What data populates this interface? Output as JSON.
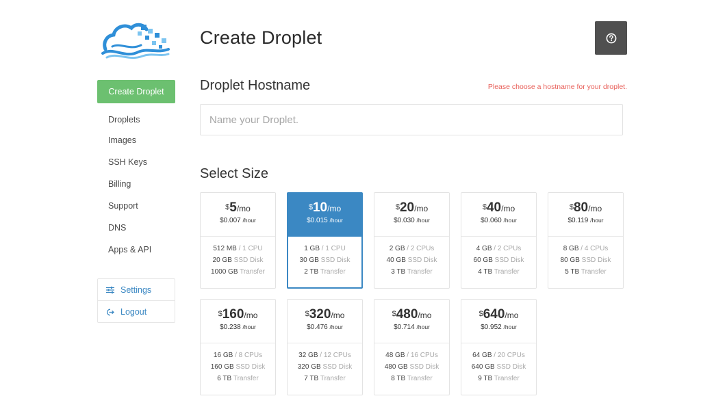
{
  "app": {
    "logo_icon": "cloud-logo-icon",
    "accent": "#3b88c3",
    "green": "#6cc070",
    "error_color": "#e8605a"
  },
  "sidebar": {
    "create_label": "Create Droplet",
    "items": [
      {
        "label": "Droplets"
      },
      {
        "label": "Images"
      },
      {
        "label": "SSH Keys"
      },
      {
        "label": "Billing"
      },
      {
        "label": "Support"
      },
      {
        "label": "DNS"
      },
      {
        "label": "Apps & API"
      }
    ],
    "settings_label": "Settings",
    "settings_icon": "sliders-icon",
    "logout_label": "Logout",
    "logout_icon": "logout-icon"
  },
  "header": {
    "title": "Create Droplet",
    "help_icon": "question-icon"
  },
  "hostname": {
    "title": "Droplet Hostname",
    "error": "Please choose a hostname for your droplet.",
    "placeholder": "Name your Droplet.",
    "value": ""
  },
  "size": {
    "title": "Select Size",
    "selected_index": 1,
    "plans": [
      {
        "currency": "$",
        "amount": "5",
        "per_month": "/mo",
        "hourly": "$0.007",
        "per_hour": "/hour",
        "ram": "512 MB",
        "cpu": "/ 1 CPU",
        "disk_size": "20 GB",
        "disk_label": "SSD Disk",
        "transfer": "1000 GB",
        "transfer_label": "Transfer"
      },
      {
        "currency": "$",
        "amount": "10",
        "per_month": "/mo",
        "hourly": "$0.015",
        "per_hour": "/hour",
        "ram": "1 GB",
        "cpu": "/ 1 CPU",
        "disk_size": "30 GB",
        "disk_label": "SSD Disk",
        "transfer": "2 TB",
        "transfer_label": "Transfer"
      },
      {
        "currency": "$",
        "amount": "20",
        "per_month": "/mo",
        "hourly": "$0.030",
        "per_hour": "/hour",
        "ram": "2 GB",
        "cpu": "/ 2 CPUs",
        "disk_size": "40 GB",
        "disk_label": "SSD Disk",
        "transfer": "3 TB",
        "transfer_label": "Transfer"
      },
      {
        "currency": "$",
        "amount": "40",
        "per_month": "/mo",
        "hourly": "$0.060",
        "per_hour": "/hour",
        "ram": "4 GB",
        "cpu": "/ 2 CPUs",
        "disk_size": "60 GB",
        "disk_label": "SSD Disk",
        "transfer": "4 TB",
        "transfer_label": "Transfer"
      },
      {
        "currency": "$",
        "amount": "80",
        "per_month": "/mo",
        "hourly": "$0.119",
        "per_hour": "/hour",
        "ram": "8 GB",
        "cpu": "/ 4 CPUs",
        "disk_size": "80 GB",
        "disk_label": "SSD Disk",
        "transfer": "5 TB",
        "transfer_label": "Transfer"
      },
      {
        "currency": "$",
        "amount": "160",
        "per_month": "/mo",
        "hourly": "$0.238",
        "per_hour": "/hour",
        "ram": "16 GB",
        "cpu": "/ 8 CPUs",
        "disk_size": "160 GB",
        "disk_label": "SSD Disk",
        "transfer": "6 TB",
        "transfer_label": "Transfer"
      },
      {
        "currency": "$",
        "amount": "320",
        "per_month": "/mo",
        "hourly": "$0.476",
        "per_hour": "/hour",
        "ram": "32 GB",
        "cpu": "/ 12 CPUs",
        "disk_size": "320 GB",
        "disk_label": "SSD Disk",
        "transfer": "7 TB",
        "transfer_label": "Transfer"
      },
      {
        "currency": "$",
        "amount": "480",
        "per_month": "/mo",
        "hourly": "$0.714",
        "per_hour": "/hour",
        "ram": "48 GB",
        "cpu": "/ 16 CPUs",
        "disk_size": "480 GB",
        "disk_label": "SSD Disk",
        "transfer": "8 TB",
        "transfer_label": "Transfer"
      },
      {
        "currency": "$",
        "amount": "640",
        "per_month": "/mo",
        "hourly": "$0.952",
        "per_hour": "/hour",
        "ram": "64 GB",
        "cpu": "/ 20 CPUs",
        "disk_size": "640 GB",
        "disk_label": "SSD Disk",
        "transfer": "9 TB",
        "transfer_label": "Transfer"
      }
    ]
  }
}
